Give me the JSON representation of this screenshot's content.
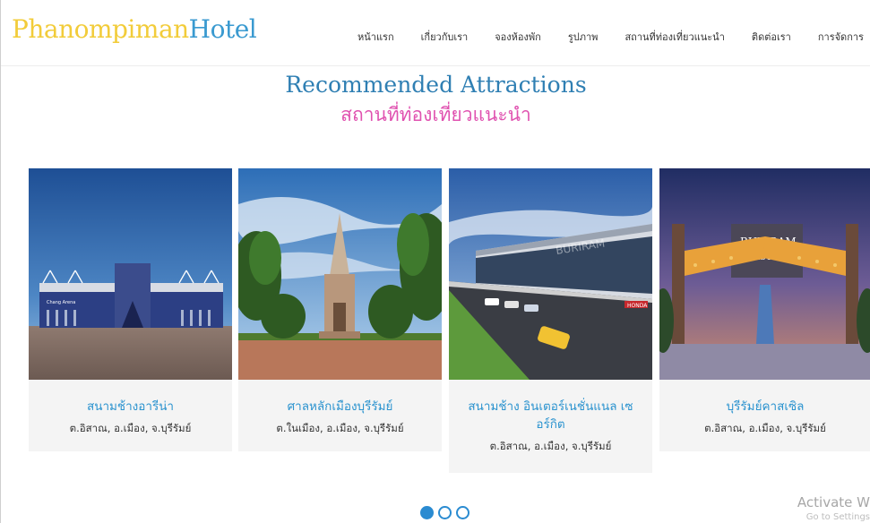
{
  "logo": {
    "part1": "Phanompiman",
    "part2": "Hotel"
  },
  "nav": {
    "items": [
      "หน้าแรก",
      "เกี่ยวกับเรา",
      "จองห้องพัก",
      "รูปภาพ",
      "สถานที่ท่องเที่ยวแนะนำ",
      "ติดต่อเรา",
      "การจัดการ"
    ]
  },
  "section": {
    "title_en": "Recommended Attractions",
    "title_th": "สถานที่ท่องเที่ยวแนะนำ"
  },
  "cards": [
    {
      "name": "สนามช้างอารีน่า",
      "address": "ต.อิสาณ, อ.เมือง, จ.บุรีรัมย์"
    },
    {
      "name": "ศาลหลักเมืองบุรีรัมย์",
      "address": "ต.ในเมือง, อ.เมือง, จ.บุรีรัมย์"
    },
    {
      "name": "สนามช้าง อินเตอร์เนชั่นแนล เซอร์กิต",
      "address": "ต.อิสาณ, อ.เมือง, จ.บุรีรัมย์"
    },
    {
      "name": "บุรีรัมย์คาสเซิล",
      "address": "ต.อิสาณ, อ.เมือง, จ.บุรีรัมย์"
    }
  ],
  "photo_text": {
    "stadium_sign": "Chang Arena",
    "circuit_sign": "BURIRAM",
    "circuit_sponsor": "HONDA",
    "castle_sign_1": "BURIRAM",
    "castle_sign_2": "CASTLE"
  },
  "carousel": {
    "pages": 3,
    "active": 1
  },
  "watermark": {
    "line1": "Activate W",
    "line2": "Go to Settings"
  },
  "colors": {
    "brand_yellow": "#f2cc3a",
    "brand_blue": "#3a9ad0",
    "pink": "#e052b0",
    "link_blue": "#2b93cf"
  }
}
